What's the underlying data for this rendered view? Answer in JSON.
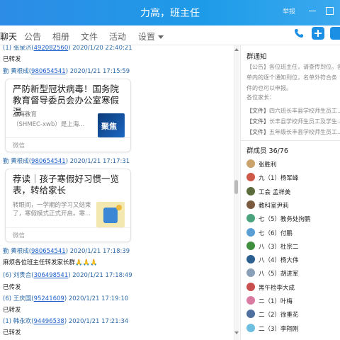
{
  "window": {
    "title": "力高，班主任",
    "report_label": "举报"
  },
  "tabs": [
    {
      "label": "聊天",
      "active": true
    },
    {
      "label": "公告",
      "active": false
    },
    {
      "label": "相册",
      "active": false
    },
    {
      "label": "文件",
      "active": false
    },
    {
      "label": "活动",
      "active": false
    },
    {
      "label": "设置",
      "active": false
    }
  ],
  "toolbar": {
    "phone_icon": "phone-icon",
    "add_icon": "plus-icon",
    "member_icon": "user-icon"
  },
  "chat": {
    "messages": [
      {
        "prefix": "(1) 张泉济(",
        "qq": "492082560",
        "time": ") 2020/1/20 22:40:21"
      },
      {
        "body": "已转发"
      },
      {
        "prefix": "勤  黄根成(",
        "qq": "980654541",
        "time": ") 2020/1/21 17:15:59"
      },
      {
        "card": {
          "title": "严防新型冠状病毒！国务院教育督导委员会办公室寒假温...",
          "source": "上海教育",
          "sub": "（SHMEC-xwb）是上海...",
          "footer": "微信",
          "thumb_text": "聚焦"
        }
      },
      {
        "prefix": "勤  黄根成(",
        "qq": "980654541",
        "time": ") 2020/1/21 17:17:31"
      },
      {
        "card": {
          "title": "荐读｜孩子寒假好习惯一览表，转给家长",
          "sub": "转眼间，一学期的学习又结束了，寒假模式正式开启。寒...",
          "footer": "微信"
        }
      },
      {
        "prefix": "勤  黄根成(",
        "qq": "980654541",
        "time": ") 2020/1/21 17:18:39"
      },
      {
        "body": "麻烦各位班主任转发家长群",
        "emoji": "🙏🙏🙏"
      },
      {
        "prefix": "(6) 刘贵合(",
        "qq": "306498541",
        "time": ") 2020/1/21 17:18:49"
      },
      {
        "body": "已传发"
      },
      {
        "prefix": "(6) 王庆国(",
        "qq": "95241609",
        "time": ") 2020/1/21 17:19:10"
      },
      {
        "body": "已转发"
      },
      {
        "prefix": "(1) 韩永欢(",
        "qq": "94496538",
        "time": ") 2020/1/21 17:21:34"
      },
      {
        "body": "已转发"
      }
    ]
  },
  "notice": {
    "title": "群通知",
    "lines": [
      {
        "text": "【公告】各位班主任，请查传到位。各"
      },
      {
        "text": "单内的逐个通知到位，名单外符合条"
      },
      {
        "text": "件的也可以申报。"
      },
      {
        "text": "各位家长："
      },
      {
        "tag": "【文件】",
        "text": "四六班长丰县学校师生员工..."
      },
      {
        "tag": "【文件】",
        "text": "长丰县学校师生员工及学生..."
      },
      {
        "tag": "【文件】",
        "text": "五年级长丰县学校师生员工..."
      }
    ]
  },
  "members": {
    "title": "群成员 36/76",
    "list": [
      {
        "name": "张胜利",
        "color": "#c9a36b"
      },
      {
        "name": "九（1）杨军峰",
        "color": "#d05a4a"
      },
      {
        "name": "工会 孟祥美",
        "color": "#5b6b3b"
      },
      {
        "name": "教科室尹莉",
        "color": "#7a5a3e"
      },
      {
        "name": "七（5）教务处拘鹏",
        "color": "#4aa37c"
      },
      {
        "name": "七（6）付鹏",
        "color": "#5a9fd4"
      },
      {
        "name": "八（3）杜宗二",
        "color": "#3f8f3f"
      },
      {
        "name": "八（4）杨大伟",
        "color": "#2b5f8f"
      },
      {
        "name": "八（5）胡进军",
        "color": "#8aa0b8"
      },
      {
        "name": "黑午检李大成",
        "color": "#c94f4f"
      },
      {
        "name": "二（1）叶梅",
        "color": "#d97aa0"
      },
      {
        "name": "二（2）徐重花",
        "color": "#4f6f9f"
      },
      {
        "name": "二（3）李翔刚",
        "color": "#6fbfe0"
      }
    ]
  }
}
